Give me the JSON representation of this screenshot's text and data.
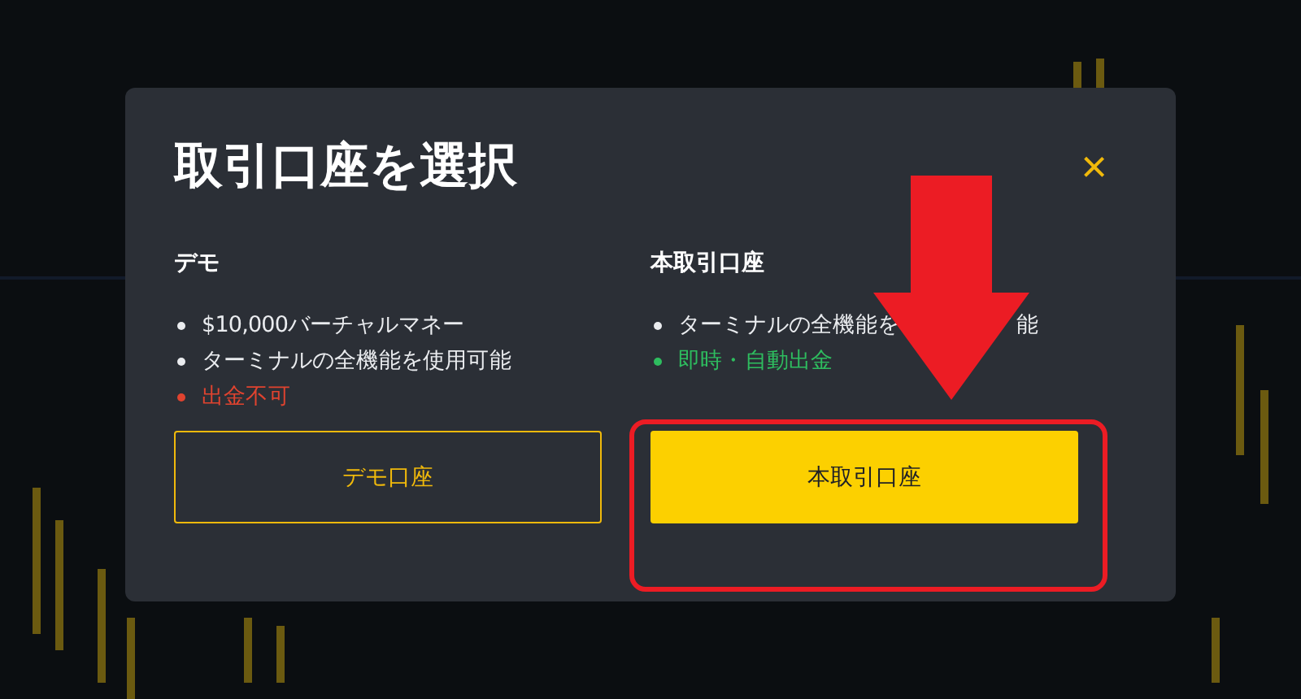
{
  "dialog": {
    "title": "取引口座を選択",
    "close": "×",
    "columns": [
      {
        "heading": "デモ",
        "items": [
          {
            "text": "$10,000バーチャルマネー",
            "kind": "normal"
          },
          {
            "text": "ターミナルの全機能を使用可能",
            "kind": "normal"
          },
          {
            "text": "出金不可",
            "kind": "negative"
          }
        ],
        "button": {
          "label": "デモ口座",
          "kind": "outline"
        }
      },
      {
        "heading": "本取引口座",
        "items": [
          {
            "text": "ターミナルの全機能を",
            "after_arrow": "能",
            "kind": "normal"
          },
          {
            "text": "即時・自動出金",
            "kind": "positive"
          }
        ],
        "button": {
          "label": "本取引口座",
          "kind": "filled"
        }
      }
    ]
  }
}
